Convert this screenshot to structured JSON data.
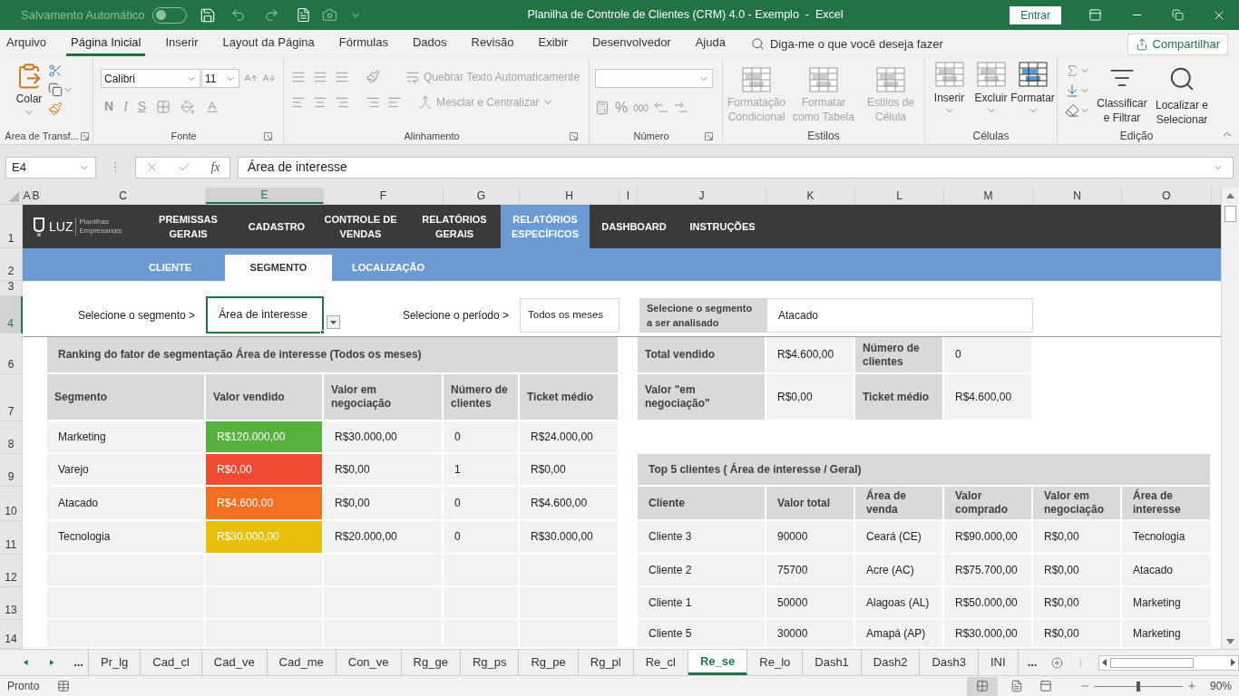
{
  "title_bar": {
    "autosave_label": "Salvamento Automático",
    "autosave_on": false,
    "title": "Planilha de Controle de Clientes (CRM) 4.0 - Exemplo  -  Excel",
    "sign_in": "Entrar"
  },
  "menu": {
    "tabs": [
      {
        "label": "Arquivo",
        "selected": false
      },
      {
        "label": "Página Inicial",
        "selected": true
      },
      {
        "label": "Inserir",
        "selected": false
      },
      {
        "label": "Layout da Página",
        "selected": false
      },
      {
        "label": "Fórmulas",
        "selected": false
      },
      {
        "label": "Dados",
        "selected": false
      },
      {
        "label": "Revisão",
        "selected": false
      },
      {
        "label": "Exibir",
        "selected": false
      },
      {
        "label": "Desenvolvedor",
        "selected": false
      },
      {
        "label": "Ajuda",
        "selected": false
      }
    ],
    "tell_me": "Diga-me o que você deseja fazer",
    "share": "Compartilhar"
  },
  "ribbon": {
    "clipboard": {
      "paste": "Colar",
      "label": "Área de Transf..."
    },
    "font": {
      "name": "Calibri",
      "size": "11",
      "bold": "N",
      "italic": "I",
      "underline": "S",
      "label": "Fonte"
    },
    "alignment": {
      "wrap": {
        "label": "Quebrar Texto Automaticamente",
        "disabled": true
      },
      "merge": {
        "label": "Mesclar e Centralizar",
        "disabled": true
      },
      "label": "Alinhamento"
    },
    "number": {
      "percent": "%",
      "thousands": "000",
      "label": "Número"
    },
    "styles": {
      "buttons": [
        {
          "label": "Formatação Condicional",
          "disabled": true
        },
        {
          "label": "Formatar como Tabela",
          "disabled": true
        },
        {
          "label": "Estilos de Célula",
          "disabled": true
        }
      ],
      "label": "Estilos"
    },
    "cells": {
      "buttons": [
        "Inserir",
        "Excluir",
        "Formatar"
      ],
      "label": "Células"
    },
    "editing": {
      "buttons": [
        "Classificar e Filtrar",
        "Localizar e Selecionar"
      ],
      "label": "Edição"
    }
  },
  "formula_bar": {
    "name_box": "E4",
    "function_label": "fx",
    "value": "Área de interesse"
  },
  "column_headers": [
    {
      "label": "A",
      "selected": false
    },
    {
      "label": "B",
      "selected": false
    },
    {
      "label": "C",
      "selected": false
    },
    {
      "label": "E",
      "selected": true
    },
    {
      "label": "F",
      "selected": false
    },
    {
      "label": "G",
      "selected": false
    },
    {
      "label": "H",
      "selected": false
    },
    {
      "label": "I",
      "selected": false
    },
    {
      "label": "J",
      "selected": false
    },
    {
      "label": "K",
      "selected": false
    },
    {
      "label": "L",
      "selected": false
    },
    {
      "label": "M",
      "selected": false
    },
    {
      "label": "N",
      "selected": false
    },
    {
      "label": "O",
      "selected": false
    }
  ],
  "row_numbers": [
    {
      "label": "1",
      "selected": false
    },
    {
      "label": "2",
      "selected": false
    },
    {
      "label": "3",
      "selected": false
    },
    {
      "label": "4",
      "selected": true
    },
    {
      "label": "6",
      "selected": false
    },
    {
      "label": "7",
      "selected": false
    },
    {
      "label": "8",
      "selected": false
    },
    {
      "label": "9",
      "selected": false
    },
    {
      "label": "10",
      "selected": false
    },
    {
      "label": "11",
      "selected": false
    },
    {
      "label": "12",
      "selected": false
    },
    {
      "label": "13",
      "selected": false
    },
    {
      "label": "14",
      "selected": false
    }
  ],
  "logo": {
    "name": "LUZ",
    "tagline": "Planilhas Empresariais"
  },
  "nav": [
    {
      "label": "PREMISSAS GERAIS",
      "selected": false
    },
    {
      "label": "CADASTRO",
      "selected": false
    },
    {
      "label": "CONTROLE DE VENDAS",
      "selected": false
    },
    {
      "label": "RELATÓRIOS GERAIS",
      "selected": false
    },
    {
      "label": "RELATÓRIOS ESPECÍFICOS",
      "selected": true
    },
    {
      "label": "DASHBOARD",
      "selected": false
    },
    {
      "label": "INSTRUÇÕES",
      "selected": false
    }
  ],
  "subnav": [
    {
      "label": "CLIENTE",
      "selected": false
    },
    {
      "label": "SEGMENTO",
      "selected": true
    },
    {
      "label": "LOCALIZAÇÃO",
      "selected": false
    }
  ],
  "filters": {
    "segment_label": "Selecione o segmento >",
    "segment_value": "Área de interesse",
    "period_label": "Selecione o período >",
    "period_value": "Todos os meses"
  },
  "ranking": {
    "title": "Ranking do fator de segmentação Área de interesse (Todos os meses)",
    "columns": [
      "Segmento",
      "Valor vendido",
      "Valor em negociação",
      "Número de clientes",
      "Ticket médio"
    ],
    "rows": [
      {
        "segment": "Marketing",
        "sold": "R$120.000,00",
        "color": "#55b23e",
        "negotiation": "R$30.000,00",
        "clients": "0",
        "ticket": "R$24.000,00"
      },
      {
        "segment": "Varejo",
        "sold": "R$0,00",
        "color": "#f04a33",
        "negotiation": "R$0,00",
        "clients": "1",
        "ticket": "R$0,00"
      },
      {
        "segment": "Atacado",
        "sold": "R$4.600,00",
        "color": "#f27024",
        "negotiation": "R$0,00",
        "clients": "0",
        "ticket": "R$4.600,00"
      },
      {
        "segment": "Tecnologia",
        "sold": "R$30.000,00",
        "color": "#e8c00c",
        "negotiation": "R$20.000,00",
        "clients": "0",
        "ticket": "R$30.000,00"
      }
    ]
  },
  "segment_panel": {
    "label": "Selecione o segmento a ser analisado",
    "value": "Atacado",
    "stats": [
      {
        "label": "Total vendido",
        "value": "R$4.600,00"
      },
      {
        "label": "Número de clientes",
        "value": "0"
      },
      {
        "label": "Valor \"em negociação\"",
        "value": "R$0,00"
      },
      {
        "label": "Ticket médio",
        "value": "R$4.600,00"
      }
    ]
  },
  "top_clients": {
    "title": "Top 5 clientes ( Área de interesse / Geral)",
    "columns": [
      "Cliente",
      "Valor total",
      "Área de venda",
      "Valor comprado",
      "Valor em negociação",
      "Área de interesse"
    ],
    "rows": [
      [
        "Cliente 3",
        "90000",
        "Ceará (CE)",
        "R$90.000,00",
        "R$0,00",
        "Tecnologia"
      ],
      [
        "Cliente 2",
        "75700",
        "Acre (AC)",
        "R$75.700,00",
        "R$0,00",
        "Atacado"
      ],
      [
        "Cliente 1",
        "50000",
        "Alagoas (AL)",
        "R$50.000,00",
        "R$0,00",
        "Marketing"
      ],
      [
        "Cliente 5",
        "30000",
        "Amapá (AP)",
        "R$30.000,00",
        "R$0,00",
        "Marketing"
      ]
    ]
  },
  "sheet_tabs": {
    "overflow_left": "...",
    "overflow_right": "...",
    "tabs": [
      {
        "label": "Pr_lg",
        "selected": false
      },
      {
        "label": "Cad_cl",
        "selected": false
      },
      {
        "label": "Cad_ve",
        "selected": false
      },
      {
        "label": "Cad_me",
        "selected": false
      },
      {
        "label": "Con_ve",
        "selected": false
      },
      {
        "label": "Rg_ge",
        "selected": false
      },
      {
        "label": "Rg_ps",
        "selected": false
      },
      {
        "label": "Rg_pe",
        "selected": false
      },
      {
        "label": "Rg_pl",
        "selected": false
      },
      {
        "label": "Re_cl",
        "selected": false
      },
      {
        "label": "Re_se",
        "selected": true
      },
      {
        "label": "Re_lo",
        "selected": false
      },
      {
        "label": "Dash1",
        "selected": false
      },
      {
        "label": "Dash2",
        "selected": false
      },
      {
        "label": "Dash3",
        "selected": false
      },
      {
        "label": "INI",
        "selected": false
      }
    ]
  },
  "status_bar": {
    "status": "Pronto",
    "zoom": "90%",
    "zoom_level": {
      "level": 0.5
    }
  }
}
